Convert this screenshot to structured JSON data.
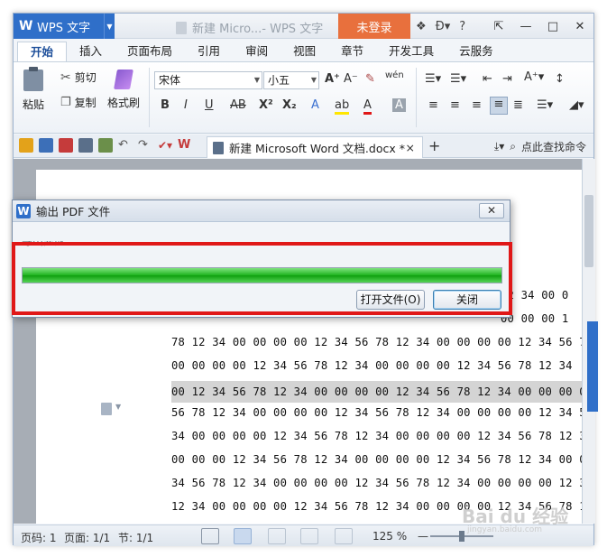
{
  "app": {
    "brand": "WPS 文字",
    "doc_title": "新建 Micro...- WPS 文字",
    "login": "未登录",
    "help": "?",
    "minimize": "—",
    "maximize": "□",
    "close": "✕"
  },
  "menu": {
    "tabs": [
      "开始",
      "插入",
      "页面布局",
      "引用",
      "审阅",
      "视图",
      "章节",
      "开发工具",
      "云服务"
    ]
  },
  "ribbon": {
    "paste": "粘贴",
    "cut": "剪切",
    "copy": "复制",
    "format_painter": "格式刷",
    "font_name": "宋体",
    "font_size": "小五",
    "bold": "B",
    "italic": "I",
    "underline": "U",
    "strike": "AB",
    "superscript": "X²",
    "subscript": "X₂",
    "font_color": "A",
    "phonetic": "wén",
    "grow_font": "A⁺",
    "shrink_font": "A⁻"
  },
  "quickbar": {
    "doc_tab": "新建 Microsoft Word 文档.docx *",
    "doc_tab_close": "×",
    "new_tab": "+",
    "find_command": "点此查找命令"
  },
  "document": {
    "lines": [
      "12 34 00 0",
      "00 00 00 1",
      "78 12 34 00 00 00 00 12 34 56 78 12 34 00 00 00 00 12 34 56 7",
      "00 00 00 00 12 34 56 78 12 34 00 00 00 00 12 34 56 78 12 34",
      "00 12 34 56 78 12 34 00 00 00 00 12 34 56 78 12 34 00 00 00 0",
      "56 78 12 34 00 00 00 00 12 34 56 78 12 34 00 00 00 00 12 34 5",
      "34 00 00 00 00 12 34 56 78 12 34 00 00 00 00 12 34 56 78 12 3",
      "00 00 00 12 34 56 78 12 34 00 00 00 00 12 34 56 78 12 34 00 0",
      "34 56 78 12 34 00 00 00 00 12 34 56 78 12 34 00 00 00 00 12 3",
      "12 34 00 00 00 00 12 34 56 78 12 34 00 00 00 00 12 34 56 78 1"
    ]
  },
  "dialog": {
    "title": "输出 PDF 文件",
    "close": "✕",
    "status": "导出完成",
    "progress": 1.0,
    "open_file": "打开文件(O)",
    "close_btn": "关闭"
  },
  "statusbar": {
    "page_num": "页码: 1",
    "pages": "页面: 1/1",
    "section": "节: 1/1",
    "zoom": "125 %"
  },
  "watermark": {
    "main": "Bai du 经验",
    "sub": "jingyan.baidu.com"
  },
  "colors": {
    "brand_blue": "#2f6fc9",
    "login_orange": "#e8703d",
    "highlight_red": "#e01818",
    "progress_green": "#1fb41f"
  }
}
